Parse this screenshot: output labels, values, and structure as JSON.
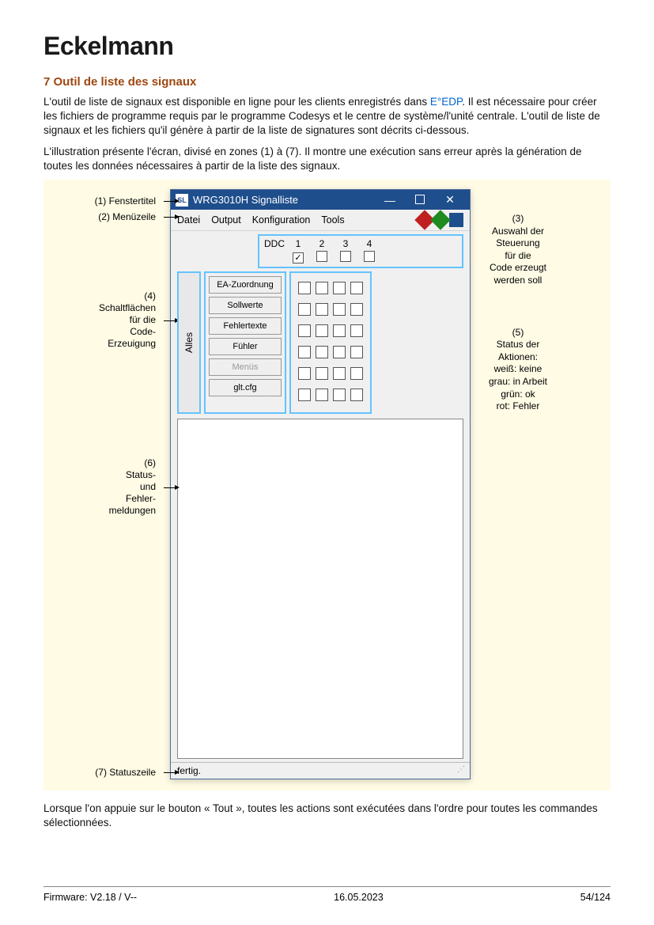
{
  "brand": "Eckelmann",
  "section_title": "7 Outil de liste des signaux",
  "para1_a": "L'outil de liste de signaux est disponible en ligne pour les clients enregistrés dans ",
  "para1_link": "E°EDP",
  "para1_b": ". Il est nécessaire pour créer les fichiers de programme requis par le programme Codesys et le centre de système/l'unité centrale. L'outil de liste de signaux et les fichiers qu'il génère à partir de la liste de signatures sont décrits ci-dessous.",
  "para2": "L'illustration présente l'écran, divisé en zones (1) à (7). Il montre une exécution sans erreur après la génération de toutes les données nécessaires à partir de la liste des signaux.",
  "labels": {
    "l1": "(1) Fenstertitel",
    "l2": "(2) Menüzeile",
    "l4a": "(4)",
    "l4b": "Schaltflächen",
    "l4c": "für die",
    "l4d": "Code-",
    "l4e": "Erzeuigung",
    "l6a": "(6)",
    "l6b": "Status-",
    "l6c": "und",
    "l6d": "Fehler-",
    "l6e": "meldungen",
    "l7": "(7) Statuszeile",
    "r3a": "(3)",
    "r3b": "Auswahl der",
    "r3c": "Steuerung",
    "r3d": "für die",
    "r3e": "Code erzeugt",
    "r3f": "werden soll",
    "r5a": "(5)",
    "r5b": "Status der",
    "r5c": "Aktionen:",
    "r5d": "weiß: keine",
    "r5e": "grau: in Arbeit",
    "r5f": "grün: ok",
    "r5g": "rot: Fehler"
  },
  "window": {
    "title": "WRG3010H Signalliste",
    "menu": {
      "m1": "Datei",
      "m2": "Output",
      "m3": "Konfiguration",
      "m4": "Tools"
    },
    "ddc_label": "DDC",
    "cols": [
      "1",
      "2",
      "3",
      "4"
    ],
    "alles": "Alles",
    "buttons": {
      "b1": "EA-Zuordnung",
      "b2": "Sollwerte",
      "b3": "Fehlertexte",
      "b4": "Fühler",
      "b5": "Menüs",
      "b6": "glt.cfg"
    },
    "status": "fertig."
  },
  "after_fig": "Lorsque l'on appuie sur le bouton « Tout », toutes les actions sont exécutées dans l'ordre pour toutes les commandes sélectionnées.",
  "footer": {
    "left": "Firmware: V2.18 / V--",
    "mid": "16.05.2023",
    "right": "54/124"
  }
}
